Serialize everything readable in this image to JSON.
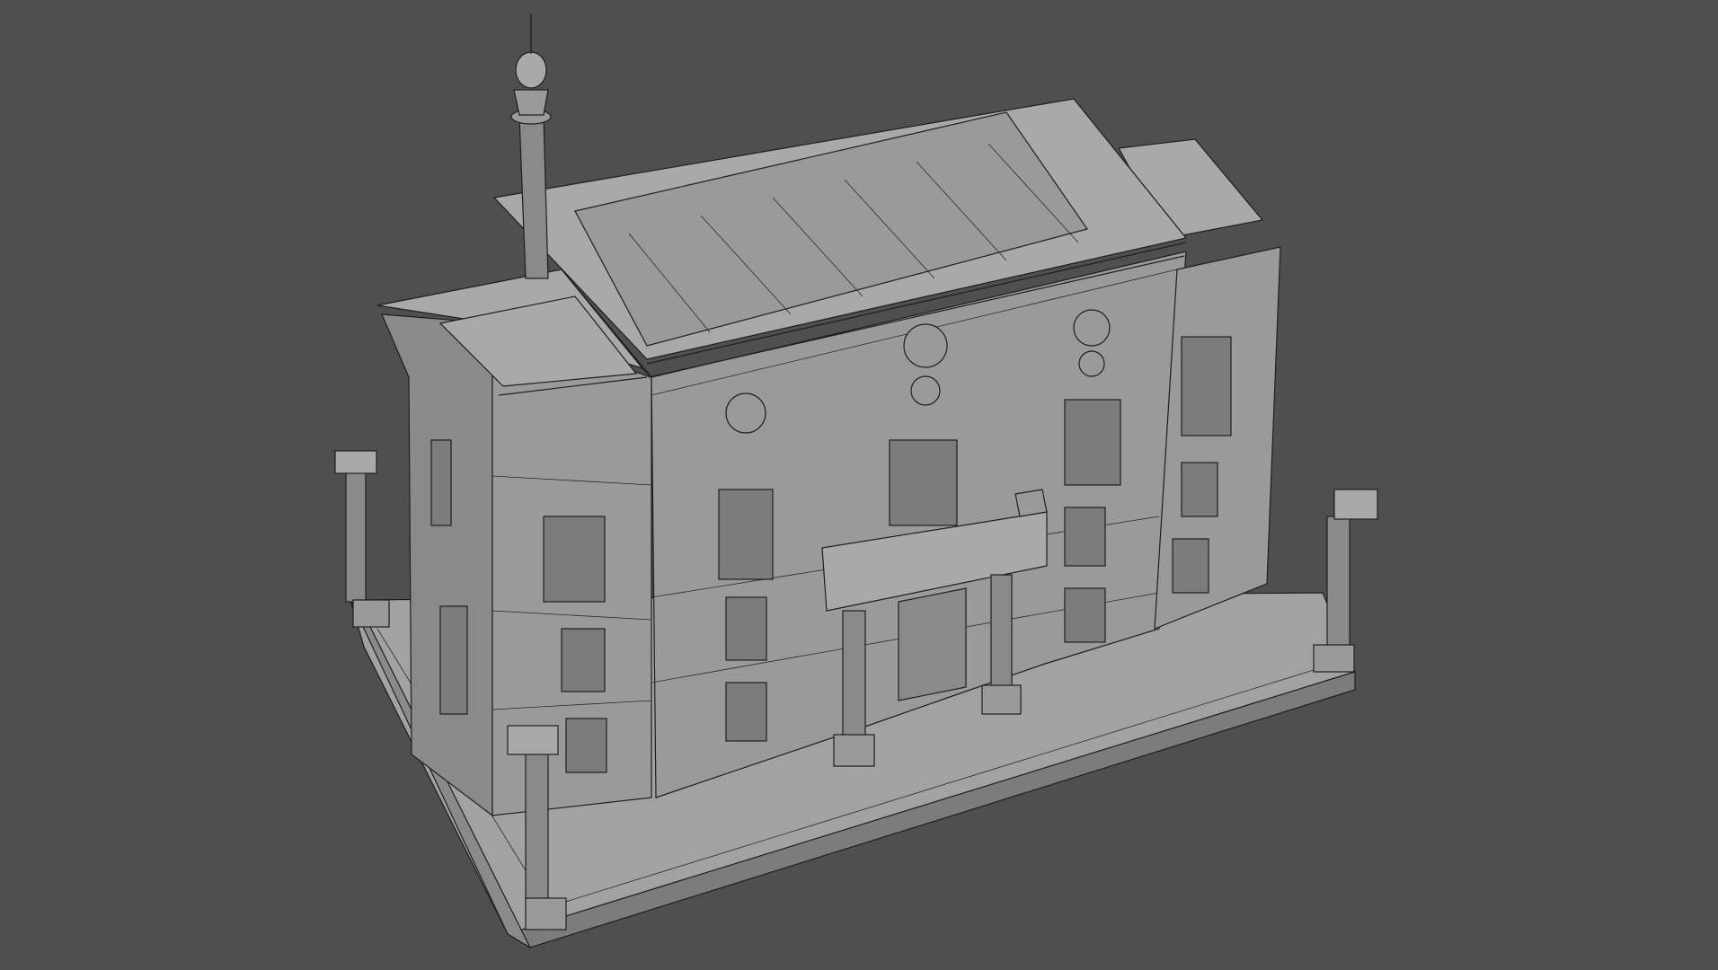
{
  "viewport": {
    "background": "#4f4f4f",
    "render_mode": "wireframe-shaded"
  },
  "model": {
    "subject": "building-with-spire-and-columns",
    "colors": {
      "wall": "#9a9a9a",
      "roof": "#a9a9a9",
      "base": "#a2a2a2",
      "wire": "#1e1e1e"
    }
  }
}
